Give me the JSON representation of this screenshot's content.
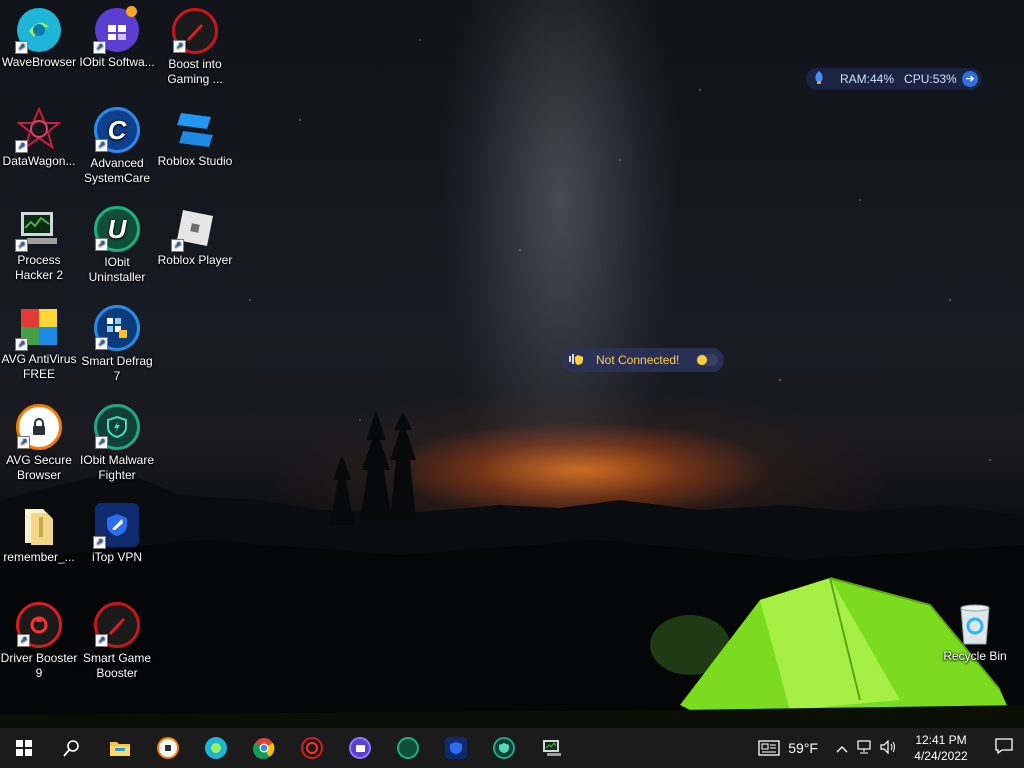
{
  "desktop": {
    "icons": [
      {
        "label": "WaveBrowser",
        "icon": "wavebrowser-icon",
        "color": "#1fb5d8"
      },
      {
        "label": "IObit Softwa...",
        "icon": "iobit-software-updater-icon",
        "color": "#5a3fd1"
      },
      {
        "label": "Boost into Gaming ...",
        "icon": "boost-gaming-icon",
        "color": "#c8161d"
      },
      {
        "label": "DataWagon...",
        "icon": "datawagon-icon",
        "color": "#b3243a"
      },
      {
        "label": "Advanced SystemCare",
        "icon": "advanced-systemcare-icon",
        "color": "#1f73d8",
        "glyph": "C"
      },
      {
        "label": "Roblox Studio",
        "icon": "roblox-studio-icon",
        "color": "#1e88e5"
      },
      {
        "label": "Process Hacker 2",
        "icon": "process-hacker-icon",
        "color": "#3b8a3e"
      },
      {
        "label": "IObit Uninstaller",
        "icon": "iobit-uninstaller-icon",
        "color": "#178f65",
        "glyph": "U"
      },
      {
        "label": "Roblox Player",
        "icon": "roblox-player-icon",
        "color": "#e6e6e6"
      },
      {
        "label": "AVG AntiVirus FREE",
        "icon": "avg-antivirus-icon",
        "color": "#e8731c"
      },
      {
        "label": "Smart Defrag 7",
        "icon": "smart-defrag-icon",
        "color": "#2a6fd6"
      },
      {
        "label": "AVG Secure Browser",
        "icon": "avg-secure-browser-icon",
        "color": "#ffffff"
      },
      {
        "label": "IObit Malware Fighter",
        "icon": "iobit-malware-fighter-icon",
        "color": "#23a685"
      },
      {
        "label": "remember_...",
        "icon": "folder-zip-icon",
        "color": "#f2d78a"
      },
      {
        "label": "iTop VPN",
        "icon": "itop-vpn-icon",
        "color": "#1c4fc8"
      },
      {
        "label": "Driver Booster 9",
        "icon": "driver-booster-icon",
        "color": "#d81e1e"
      },
      {
        "label": "Smart Game Booster",
        "icon": "smart-game-booster-icon",
        "color": "#c8161d"
      },
      {
        "label": "Recycle Bin",
        "icon": "recycle-bin-icon",
        "color": "#cfd8dc"
      }
    ]
  },
  "system_monitor": {
    "ram": "RAM:44%",
    "cpu": "CPU:53%"
  },
  "vpn_status": {
    "text": "Not Connected!"
  },
  "taskbar": {
    "apps": [
      {
        "name": "file-explorer",
        "icon": "file-explorer-icon",
        "color": "#f2c14e"
      },
      {
        "name": "avg-secure-browser",
        "icon": "avg-secure-browser-icon",
        "color": "#f5f5f5"
      },
      {
        "name": "wavebrowser",
        "icon": "wavebrowser-icon",
        "color": "#1fb5d8"
      },
      {
        "name": "chrome",
        "icon": "chrome-icon",
        "color": "#e0452d"
      },
      {
        "name": "driver-booster",
        "icon": "driver-booster-icon",
        "color": "#d81e1e"
      },
      {
        "name": "iobit-software-updater",
        "icon": "iobit-software-updater-icon",
        "color": "#5a3fd1"
      },
      {
        "name": "iobit-uninstaller",
        "icon": "iobit-uninstaller-icon",
        "color": "#178f65"
      },
      {
        "name": "itop-vpn",
        "icon": "itop-vpn-icon",
        "color": "#1c4fc8"
      },
      {
        "name": "iobit-malware-fighter",
        "icon": "iobit-malware-fighter-icon",
        "color": "#23a685"
      },
      {
        "name": "process-hacker",
        "icon": "process-hacker-icon",
        "color": "#3b8a3e"
      }
    ],
    "weather": "59°F",
    "time": "12:41 PM",
    "date": "4/24/2022"
  }
}
